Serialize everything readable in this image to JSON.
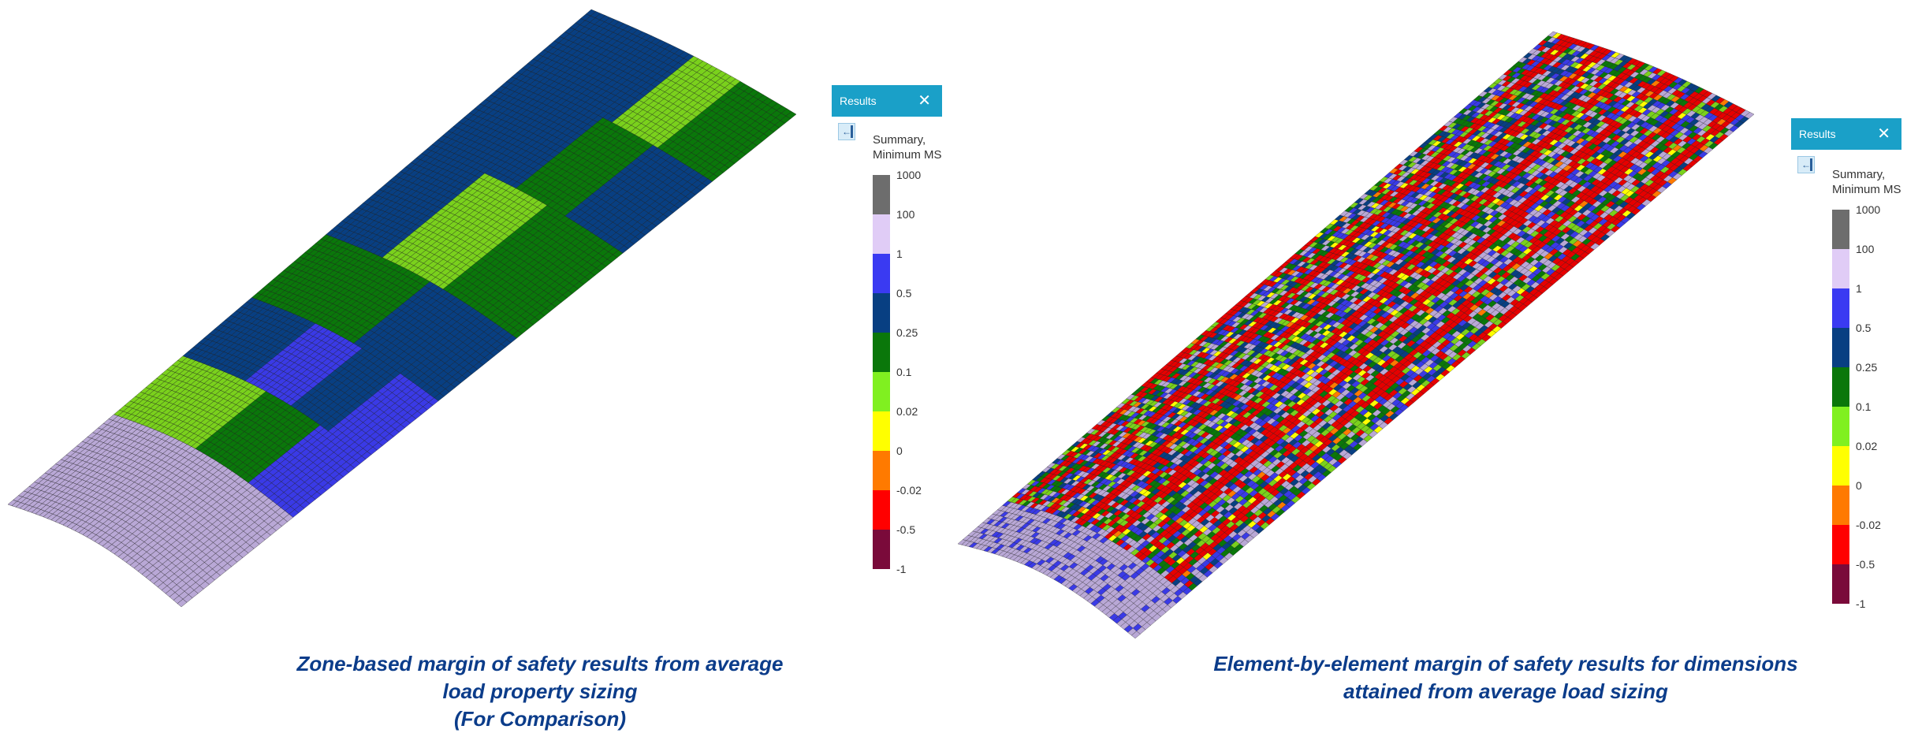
{
  "left_panel": {
    "results_widget": {
      "header_title": "Results",
      "close_glyph": "✕",
      "pin_icon": "pin-panel-icon",
      "legend_title_line1": "Summary,",
      "legend_title_line2": "Minimum MS",
      "legend_colors": [
        "#6d6d6d",
        "#e0ccf6",
        "#3a3af2",
        "#083f82",
        "#0a770a",
        "#80f020",
        "#ffff00",
        "#ff7a00",
        "#ff0000",
        "#7a0a3a"
      ],
      "legend_labels": [
        "1000",
        "100",
        "1",
        "0.5",
        "0.25",
        "0.1",
        "0.02",
        "0",
        "-0.02",
        "-0.5",
        "-1"
      ]
    },
    "caption_lines": [
      "Zone-based margin of safety results from average",
      "load property sizing",
      "(For Comparison)"
    ]
  },
  "right_panel": {
    "results_widget": {
      "header_title": "Results",
      "close_glyph": "✕",
      "pin_icon": "pin-panel-icon",
      "legend_title_line1": "Summary,",
      "legend_title_line2": "Minimum MS",
      "legend_colors": [
        "#6d6d6d",
        "#e0ccf6",
        "#3a3af2",
        "#083f82",
        "#0a770a",
        "#80f020",
        "#ffff00",
        "#ff7a00",
        "#ff0000",
        "#7a0a3a"
      ],
      "legend_labels": [
        "1000",
        "100",
        "1",
        "0.5",
        "0.25",
        "0.1",
        "0.02",
        "0",
        "-0.02",
        "-0.5",
        "-1"
      ]
    },
    "caption_lines": [
      "Element-by-element margin of safety results for dimensions",
      "attained from average load sizing"
    ]
  },
  "palette": {
    "lavender": "#b9a8d6",
    "blue": "#3a3ae6",
    "navy": "#083f82",
    "green": "#0a770a",
    "lightgreen": "#7ad11c",
    "red": "#e60000",
    "orange": "#ff7a00",
    "yellow": "#ffff00",
    "mesh_line": "#1a1a1a"
  }
}
